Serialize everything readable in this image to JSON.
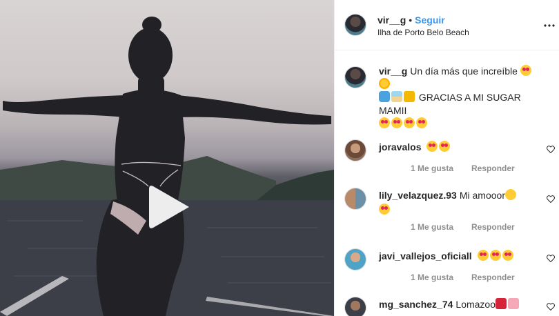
{
  "post": {
    "username": "vir__g",
    "follow_label": "Seguir",
    "separator": "•",
    "location": "Ilha de Porto Belo Beach",
    "more_icon": "more-horizontal-icon",
    "media_type": "video",
    "play_icon": "play-icon"
  },
  "caption": {
    "username": "vir__g",
    "text_line1": "Un día más que increíble",
    "text_line2": "GRACIAS A MI SUGAR MAMII",
    "emojis_line1": [
      "heart-eyes",
      "sun"
    ],
    "emojis_line2_pre": [
      "wave",
      "beach",
      "crown"
    ],
    "emojis_line3": [
      "heart-eyes",
      "heart-eyes",
      "heart-eyes",
      "heart-eyes"
    ]
  },
  "comments": [
    {
      "username": "joravalos",
      "text": "",
      "emojis": [
        "heart-eyes",
        "heart-eyes"
      ],
      "likes_label": "1 Me gusta",
      "reply_label": "Responder"
    },
    {
      "username": "lily_velazquez.93",
      "text": "Mi amooor",
      "emojis": [
        "grin"
      ],
      "emojis_line2": [
        "heart-eyes"
      ],
      "likes_label": "1 Me gusta",
      "reply_label": "Responder"
    },
    {
      "username": "javi_vallejos_oficiall",
      "text": "",
      "emojis": [
        "heart-eyes",
        "heart-eyes",
        "heart-eyes"
      ],
      "likes_label": "1 Me gusta",
      "reply_label": "Responder"
    },
    {
      "username": "mg_sanchez_74",
      "text": "Lomazoo",
      "emojis": [
        "hundred",
        "broken-heart"
      ],
      "likes_label": "",
      "reply_label": ""
    }
  ]
}
